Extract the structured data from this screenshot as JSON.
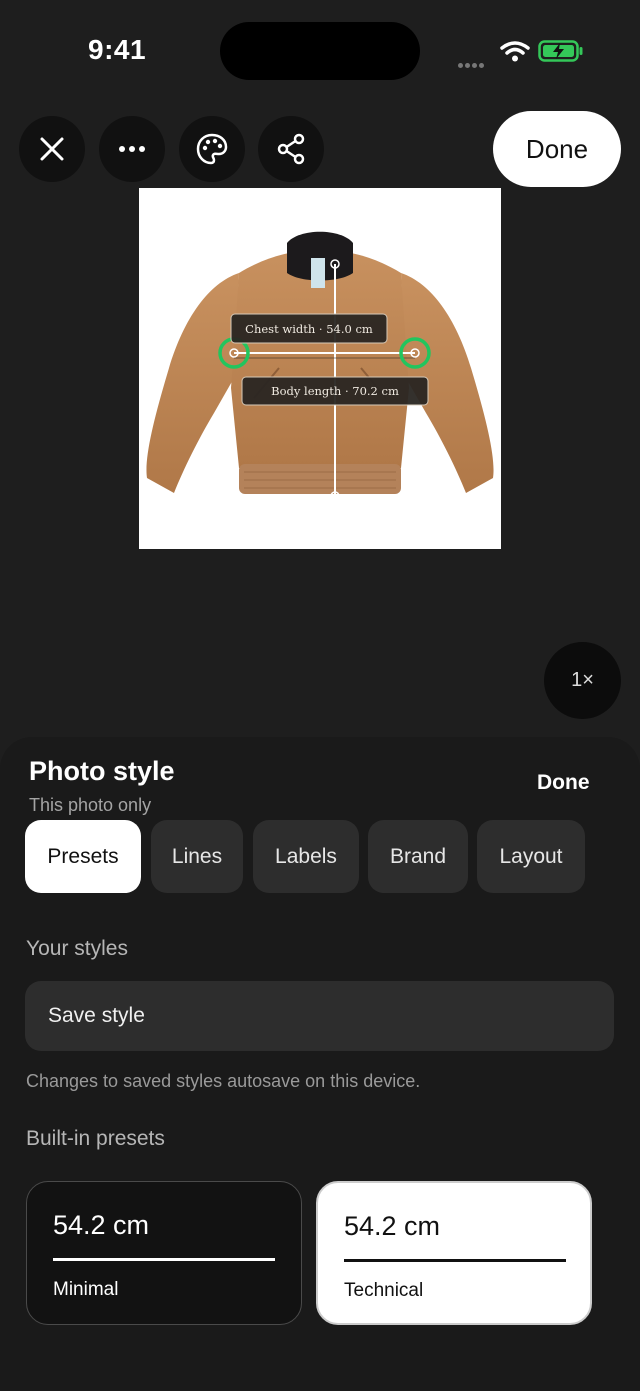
{
  "status_bar": {
    "time": "9:41"
  },
  "toolbar": {
    "close_icon": "close-icon",
    "more_icon": "more-icon",
    "palette_icon": "palette-icon",
    "share_icon": "share-icon",
    "done_label": "Done"
  },
  "photo": {
    "chest_label": "Chest width · 54.0 cm",
    "length_label": "Body length · 70.2 cm",
    "zoom_label": "1×"
  },
  "sheet": {
    "title": "Photo style",
    "subtitle": "This photo only",
    "done_label": "Done",
    "tabs": [
      {
        "label": "Presets",
        "active": true
      },
      {
        "label": "Lines"
      },
      {
        "label": "Labels"
      },
      {
        "label": "Brand"
      },
      {
        "label": "Layout"
      }
    ],
    "your_styles_label": "Your styles",
    "save_style_label": "Save style",
    "autosave_hint": "Changes to saved styles autosave on this device.",
    "builtin_label": "Built-in presets",
    "presets": [
      {
        "value": "54.2 cm",
        "name": "Minimal"
      },
      {
        "value": "54.2 cm",
        "name": "Technical"
      }
    ]
  },
  "colors": {
    "background": "#1e1e1e",
    "sheet": "#1a1a1a",
    "chip": "#2d2d2d",
    "handle_ring": "#22c55e",
    "jacket": "#c08a5a"
  }
}
